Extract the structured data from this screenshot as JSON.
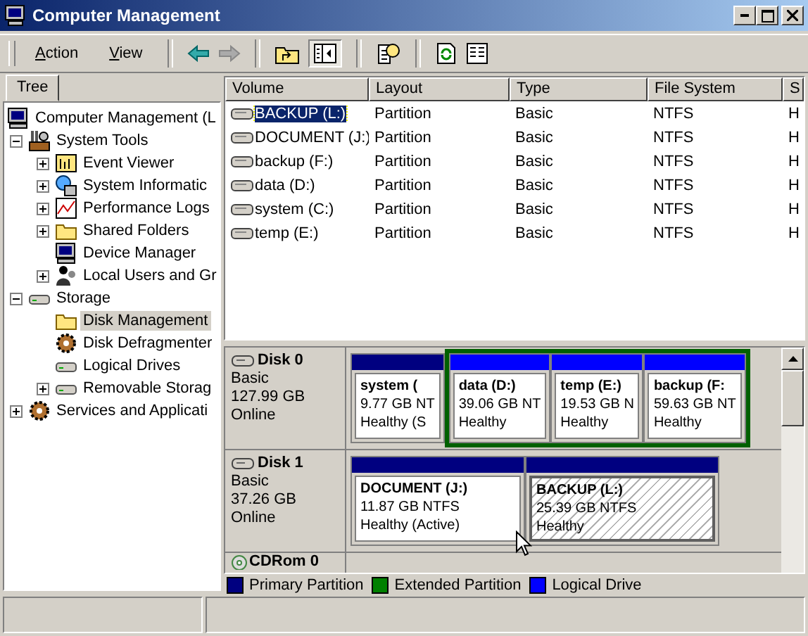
{
  "window": {
    "title": "Computer Management"
  },
  "menu": [
    "Action",
    "View"
  ],
  "tree_tab": {
    "label": "Tree",
    "selected": true
  },
  "tree": [
    {
      "label": "Computer Management (L",
      "selected": false,
      "children": [
        {
          "label": "System Tools",
          "expanded": true,
          "selected": false,
          "children": [
            {
              "label": "Event Viewer",
              "expanded": false,
              "selected": false
            },
            {
              "label": "System Informatic",
              "expanded": false,
              "selected": false
            },
            {
              "label": "Performance Logs",
              "expanded": false,
              "selected": false
            },
            {
              "label": "Shared Folders",
              "expanded": false,
              "selected": false
            },
            {
              "label": "Device Manager",
              "selected": false
            },
            {
              "label": "Local Users and Gr",
              "expanded": false,
              "selected": false
            }
          ]
        },
        {
          "label": "Storage",
          "expanded": true,
          "selected": false,
          "children": [
            {
              "label": "Disk Management",
              "selected": true
            },
            {
              "label": "Disk Defragmenter",
              "selected": false
            },
            {
              "label": "Logical Drives",
              "selected": false
            },
            {
              "label": "Removable Storag",
              "expanded": false,
              "selected": false
            }
          ]
        },
        {
          "label": "Services and Applicati",
          "expanded": false,
          "selected": false
        }
      ]
    }
  ],
  "table": {
    "columns": [
      "Volume",
      "Layout",
      "Type",
      "File System",
      "S"
    ],
    "rows": [
      {
        "volume": "BACKUP (L:)",
        "layout": "Partition",
        "type": "Basic",
        "file_system": "NTFS",
        "column_5": "H",
        "selected": true
      },
      {
        "volume": "DOCUMENT (J:)",
        "layout": "Partition",
        "type": "Basic",
        "file_system": "NTFS",
        "column_5": "H",
        "selected": false
      },
      {
        "volume": "backup (F:)",
        "layout": "Partition",
        "type": "Basic",
        "file_system": "NTFS",
        "column_5": "H",
        "selected": false
      },
      {
        "volume": "data (D:)",
        "layout": "Partition",
        "type": "Basic",
        "file_system": "NTFS",
        "column_5": "H",
        "selected": false
      },
      {
        "volume": "system (C:)",
        "layout": "Partition",
        "type": "Basic",
        "file_system": "NTFS",
        "column_5": "H",
        "selected": false
      },
      {
        "volume": "temp (E:)",
        "layout": "Partition",
        "type": "Basic",
        "file_system": "NTFS",
        "column_5": "H",
        "selected": false
      }
    ]
  },
  "disks": [
    {
      "kind": "disk",
      "name": "Disk 0",
      "type": "Basic",
      "size": "127.99 GB",
      "status": "Online",
      "partitions": [
        {
          "kind": "primary",
          "name": "system (",
          "size": "9.77 GB NT",
          "status": "Healthy (S",
          "selected": false
        },
        {
          "kind": "extended",
          "children": [
            {
              "kind": "logical",
              "name": "data  (D:)",
              "size": "39.06 GB NT",
              "status": "Healthy",
              "selected": false
            },
            {
              "kind": "logical",
              "name": "temp  (E:)",
              "size": "19.53 GB N",
              "status": "Healthy",
              "selected": false
            },
            {
              "kind": "logical",
              "name": "backup  (F:",
              "size": "59.63 GB NT",
              "status": "Healthy",
              "selected": false
            }
          ]
        }
      ]
    },
    {
      "kind": "disk",
      "name": "Disk 1",
      "type": "Basic",
      "size": "37.26 GB",
      "status": "Online",
      "partitions": [
        {
          "kind": "primary",
          "name": "DOCUMENT  (J:)",
          "size": "11.87 GB NTFS",
          "status": "Healthy (Active)",
          "selected": false
        },
        {
          "kind": "primary",
          "name": "BACKUP  (L:)",
          "size": "25.39 GB NTFS",
          "status": "Healthy",
          "selected": true
        }
      ]
    },
    {
      "kind": "cdrom",
      "name": "CDRom 0"
    }
  ],
  "legend": [
    {
      "label": "Primary Partition",
      "color": "#000080"
    },
    {
      "label": "Extended Partition",
      "color": "#008000"
    },
    {
      "label": "Logical Drive",
      "color": "#0000ff"
    }
  ]
}
